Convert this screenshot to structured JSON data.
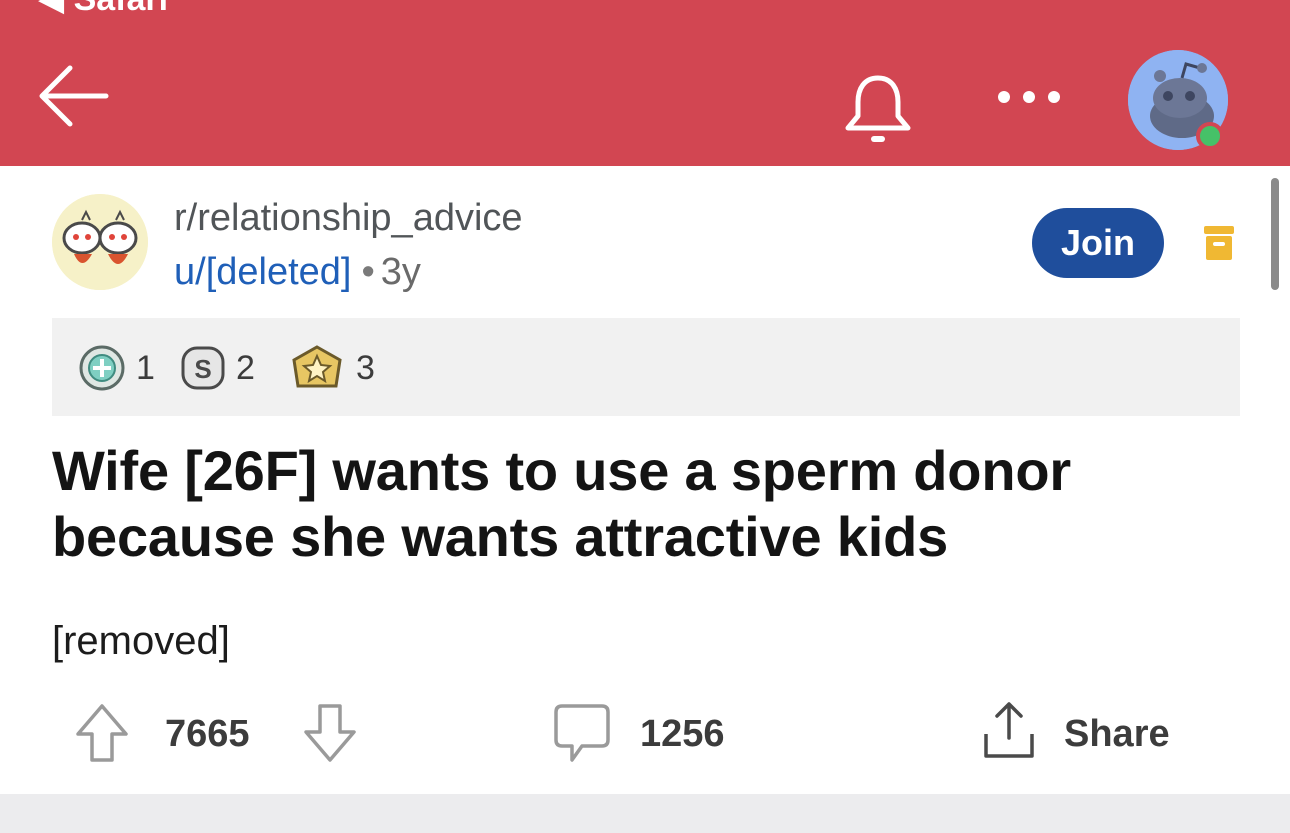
{
  "status_bar": {
    "back_app_label": "◀ Safari"
  },
  "header": {
    "more_glyph": "•••"
  },
  "post": {
    "subreddit": "r/relationship_advice",
    "author": "u/[deleted]",
    "separator": "•",
    "age": "3y",
    "join_label": "Join",
    "awards": [
      {
        "icon": "helpful-award-icon",
        "count": "1"
      },
      {
        "icon": "silver-award-icon",
        "count": "2"
      },
      {
        "icon": "gold-award-icon",
        "count": "3"
      }
    ],
    "title": "Wife [26F] wants to use a sperm donor because she wants attractive kids",
    "body": "[removed]"
  },
  "actions": {
    "score": "7665",
    "comment_count": "1256",
    "share_label": "Share"
  },
  "colors": {
    "header_bg": "#d24652",
    "join_bg": "#1f4e9c",
    "link_blue": "#1f5fb8",
    "award_bg": "#f1f1f1"
  }
}
